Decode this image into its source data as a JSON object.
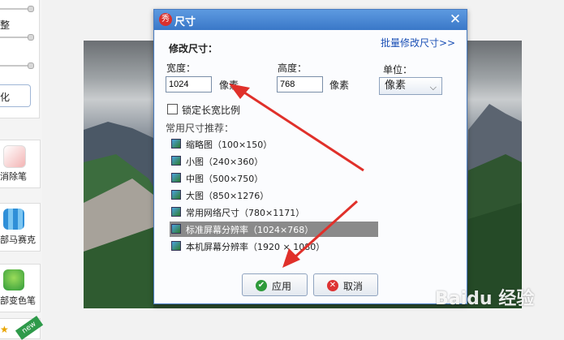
{
  "leftbar": {
    "partial_button_label": "化",
    "tools": [
      {
        "label": "消除笔",
        "icon": "eraser-icon",
        "color": "#e88a8a"
      },
      {
        "label": "部马赛克",
        "icon": "mosaic-icon",
        "color": "#3aa0e0"
      },
      {
        "label": "部变色笔",
        "icon": "color-pen-icon",
        "color": "#45b04a"
      },
      {
        "label": "new",
        "icon": "new-badge-icon",
        "color": "#2e9a4a"
      }
    ],
    "partial_label": "整"
  },
  "dialog": {
    "title": "尺寸",
    "logo_text": "秀",
    "close_glyph": "✕",
    "section_title": "修改尺寸：",
    "batch_link": "批量修改尺寸>>",
    "width_label": "宽度：",
    "width_value": "1024",
    "width_unit": "像素",
    "height_label": "高度：",
    "height_value": "768",
    "height_unit": "像素",
    "unit_label": "单位：",
    "unit_value": "像素",
    "lock_ratio_label": "锁定长宽比例",
    "lock_ratio_checked": false,
    "presets_label": "常用尺寸推荐：",
    "presets": [
      {
        "label": "缩略图（100×150）",
        "selected": false
      },
      {
        "label": "小图（240×360）",
        "selected": false
      },
      {
        "label": "中图（500×750）",
        "selected": false
      },
      {
        "label": "大图（850×1276）",
        "selected": false
      },
      {
        "label": "常用网络尺寸（780×1171）",
        "selected": false
      },
      {
        "label": "标准屏幕分辨率（1024×768）",
        "selected": true
      },
      {
        "label": "本机屏幕分辨率（1920 × 1080）",
        "selected": false
      }
    ],
    "apply_label": "应用",
    "cancel_label": "取消"
  },
  "watermark": "Baidu 经验",
  "colors": {
    "titlebar": "#3a78c8",
    "link": "#1a4fb5",
    "arrow": "#e0302a",
    "selected_row": "#8a8a8a"
  }
}
